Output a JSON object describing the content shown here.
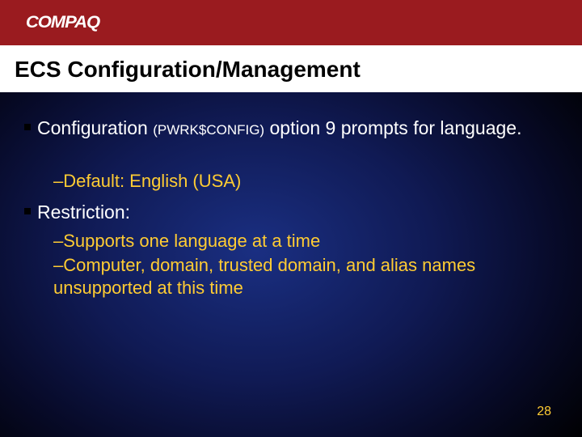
{
  "brand": "COMPAQ",
  "title": "ECS Configuration/Management",
  "bullet1_prefix": "Configuration ",
  "bullet1_cmd": "(PWRK$CONFIG)",
  "bullet1_suffix": " option 9 prompts for language.",
  "sub1": "–Default: English (USA)",
  "bullet2": "Restriction:",
  "sub2": "–Supports one language at a time",
  "sub3": "–Computer, domain, trusted domain, and alias names unsupported at this time",
  "page_number": "28"
}
